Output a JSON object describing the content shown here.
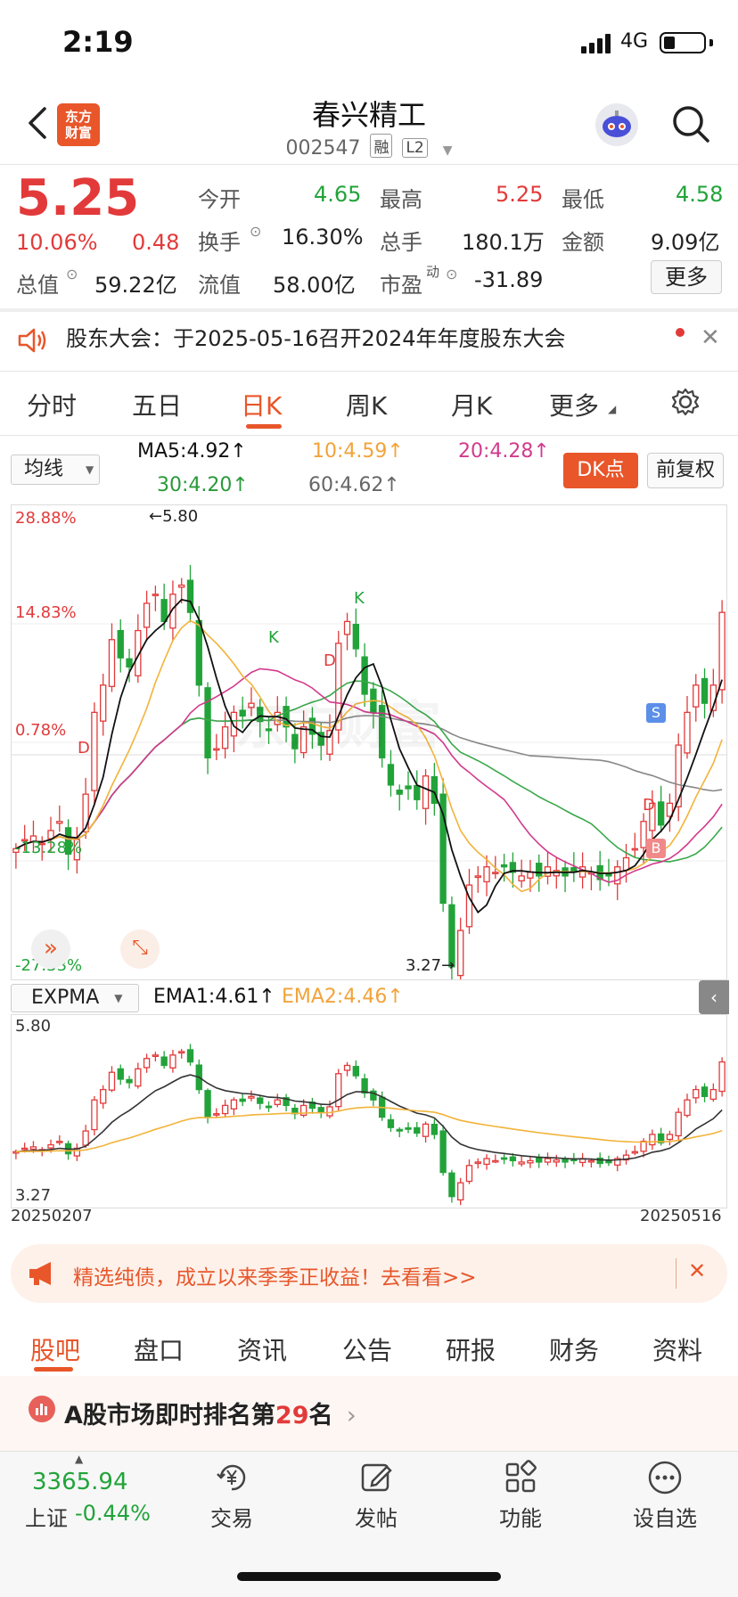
{
  "status_bar": {
    "time": "2:19",
    "network": "4G"
  },
  "header": {
    "brand_line1": "东方",
    "brand_line2": "财富",
    "stock_name": "春兴精工",
    "stock_code": "002547",
    "tag_margin": "融",
    "tag_level": "L2"
  },
  "quote": {
    "price": "5.25",
    "change_pct": "10.06%",
    "change": "0.48",
    "open_label": "今开",
    "open": "4.65",
    "high_label": "最高",
    "high": "5.25",
    "low_label": "最低",
    "low": "4.58",
    "turnover_label": "换手",
    "turnover": "16.30%",
    "volume_label": "总手",
    "volume": "180.1万",
    "amount_label": "金额",
    "amount": "9.09亿",
    "mktcap_label": "总值",
    "mktcap": "59.22亿",
    "float_label": "流值",
    "float": "58.00亿",
    "pe_label": "市盈",
    "pe_sup": "动",
    "pe": "-31.89",
    "more": "更多"
  },
  "notice": {
    "text": "股东大会：于2025-05-16召开2024年年度股东大会"
  },
  "chart_tabs": [
    "分时",
    "五日",
    "日K",
    "周K",
    "月K",
    "更多"
  ],
  "indicators": {
    "ma_select": "均线",
    "ma5": "MA5:4.92↑",
    "ma10": "10:4.59↑",
    "ma20": "20:4.28↑",
    "ma30": "30:4.20↑",
    "ma60": "60:4.62↑",
    "dk_button": "DK点",
    "adjust_button": "前复权"
  },
  "main_chart": {
    "y_top": "28.88%",
    "y_2": "14.83%",
    "y_3": "0.78%",
    "y_4": "-13.28%",
    "y_bottom": "-27.33%",
    "high_mark": "←5.80",
    "low_mark": "3.27→",
    "marker_k": "K",
    "marker_d": "D",
    "marker_s": "S",
    "marker_b": "B",
    "watermark": "东方财富"
  },
  "sub_chart": {
    "select": "EXPMA",
    "ema1": "EMA1:4.61↑",
    "ema2": "EMA2:4.46↑",
    "y_top": "5.80",
    "y_bottom": "3.27",
    "date_start": "20250207",
    "date_end": "20250516"
  },
  "ad": {
    "text": "精选纯债，成立以来季季正收益！去看看>>"
  },
  "bottom_tabs": [
    "股吧",
    "盘口",
    "资讯",
    "公告",
    "研报",
    "财务",
    "资料"
  ],
  "rank": {
    "prefix": "A股市场即时排名第",
    "number": "29",
    "suffix": "名"
  },
  "bottom_nav": {
    "index_value": "3365.94",
    "index_name": "上证",
    "index_change": "-0.44%",
    "trade": "交易",
    "post": "发帖",
    "features": "功能",
    "watchlist": "设自选"
  },
  "colors": {
    "up": "#e23a3a",
    "down": "#22a33a",
    "accent": "#e8562a"
  },
  "chart_data": {
    "type": "candlestick",
    "x_range": [
      "20250207",
      "20250516"
    ],
    "ylim": [
      3.27,
      5.8
    ],
    "closes": [
      3.95,
      4.0,
      4.02,
      3.98,
      4.05,
      4.1,
      3.92,
      4.0,
      4.25,
      4.7,
      4.85,
      5.1,
      5.0,
      4.95,
      5.15,
      5.3,
      5.35,
      5.2,
      5.35,
      5.4,
      5.25,
      4.85,
      4.45,
      4.5,
      4.62,
      4.7,
      4.68,
      4.75,
      4.65,
      4.6,
      4.7,
      4.62,
      4.5,
      4.62,
      4.58,
      4.52,
      4.6,
      5.08,
      5.2,
      5.05,
      4.8,
      4.7,
      4.45,
      4.3,
      4.25,
      4.28,
      4.22,
      4.35,
      4.2,
      3.65,
      3.3,
      3.5,
      3.75,
      3.8,
      3.85,
      3.82,
      3.85,
      3.82,
      3.8,
      3.82,
      3.8,
      3.85,
      3.83,
      3.8,
      3.82,
      3.85,
      3.82,
      3.78,
      3.8,
      3.85,
      3.9,
      3.95,
      4.1,
      4.2,
      4.08,
      4.2,
      4.52,
      4.7,
      4.85,
      4.75,
      4.85,
      5.25
    ],
    "ema1_end": 4.61,
    "ema2_end": 4.46,
    "ma": {
      "MA5": 4.92,
      "MA10": 4.59,
      "MA20": 4.28,
      "MA30": 4.2,
      "MA60": 4.62
    }
  }
}
